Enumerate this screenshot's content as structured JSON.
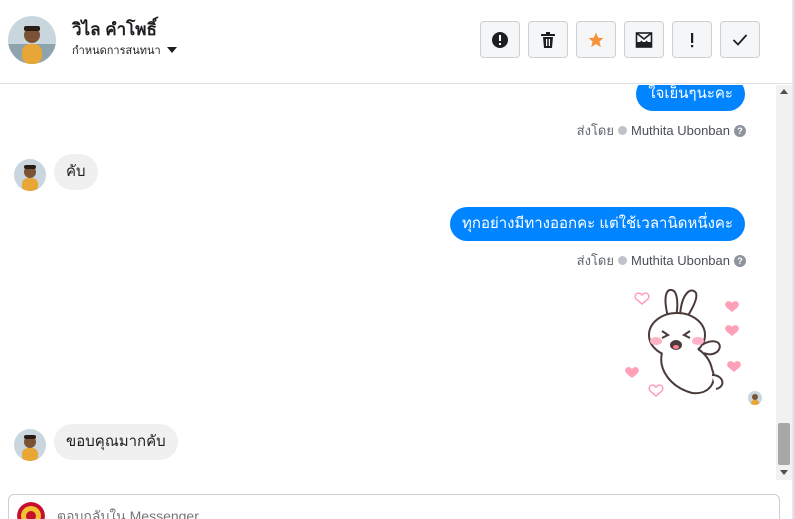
{
  "header": {
    "contact_name": "วิไล คำโพธิ์",
    "subtitle": "กำหนดการสนทนา",
    "toolbar": [
      {
        "icon": "alert-circle-icon"
      },
      {
        "icon": "trash-icon"
      },
      {
        "icon": "star-icon",
        "color": "#f7923b"
      },
      {
        "icon": "mark-unread-icon"
      },
      {
        "icon": "exclamation-icon"
      },
      {
        "icon": "check-icon"
      }
    ]
  },
  "messages": [
    {
      "direction": "out",
      "text": "ใจเย็นๆนะคะ"
    },
    {
      "sent_by_prefix": "ส่งโดย",
      "sender": "Muthita Ubonban"
    },
    {
      "direction": "in",
      "text": "คับ"
    },
    {
      "direction": "out",
      "text": "ทุกอย่างมีทางออกคะ แต่ใช้เวลานิดหนึ่งคะ"
    },
    {
      "sent_by_prefix": "ส่งโดย",
      "sender": "Muthita Ubonban"
    },
    {
      "direction": "out",
      "type": "sticker",
      "sticker": "bunny-sticker"
    },
    {
      "direction": "in",
      "text": "ขอบคุณมากคับ"
    }
  ],
  "sent_by": {
    "prefix": "ส่งโดย",
    "sender": "Muthita Ubonban",
    "help": "?"
  },
  "composer": {
    "placeholder": "ตอบกลับใน Messenger"
  },
  "colors": {
    "accent": "#0084ff",
    "incoming_bubble": "#f1f0f0",
    "star": "#f7923b"
  }
}
